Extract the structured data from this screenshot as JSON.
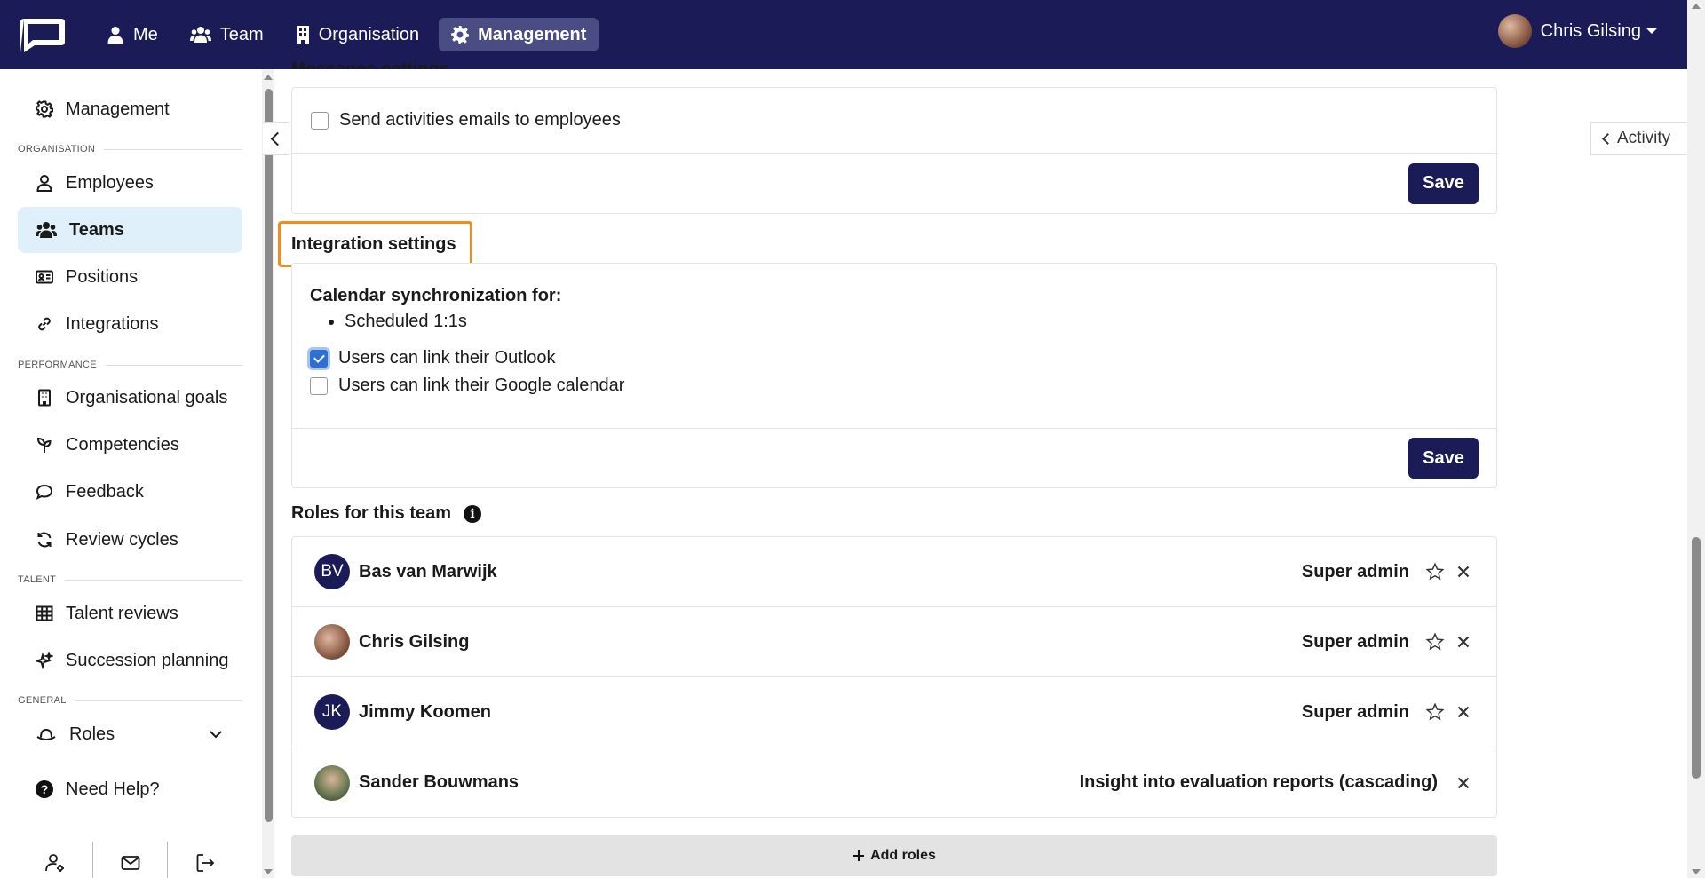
{
  "topbar": {
    "nav": [
      {
        "label": "Me",
        "icon": "person-icon"
      },
      {
        "label": "Team",
        "icon": "users-icon"
      },
      {
        "label": "Organisation",
        "icon": "building-icon"
      },
      {
        "label": "Management",
        "icon": "gear-icon",
        "active": true
      }
    ],
    "user_name": "Chris Gilsing"
  },
  "sidebar": {
    "top_item": "Management",
    "sections": {
      "organisation": "ORGANISATION",
      "performance": "PERFORMANCE",
      "talent": "TALENT",
      "general": "GENERAL"
    },
    "items": {
      "employees": "Employees",
      "teams": "Teams",
      "positions": "Positions",
      "integrations": "Integrations",
      "org_goals": "Organisational goals",
      "competencies": "Competencies",
      "feedback": "Feedback",
      "review_cycles": "Review cycles",
      "talent_reviews": "Talent reviews",
      "succession": "Succession planning",
      "roles": "Roles",
      "help": "Need Help?"
    }
  },
  "activity_label": "Activity",
  "messages": {
    "title": "Messages settings",
    "checkbox_label": "Send activities emails to employees",
    "checked": false,
    "save_label": "Save"
  },
  "integration": {
    "title": "Integration settings",
    "sync_heading": "Calendar synchronization for:",
    "sync_items": [
      "Scheduled 1:1s"
    ],
    "outlook_label": "Users can link their Outlook",
    "outlook_checked": true,
    "google_label": "Users can link their Google calendar",
    "google_checked": false,
    "save_label": "Save"
  },
  "roles": {
    "title": "Roles for this team",
    "rows": [
      {
        "initials": "BV",
        "name": "Bas van Marwijk",
        "role": "Super admin",
        "star": true
      },
      {
        "initials": "",
        "name": "Chris Gilsing",
        "role": "Super admin",
        "star": true
      },
      {
        "initials": "JK",
        "name": "Jimmy Koomen",
        "role": "Super admin",
        "star": true
      },
      {
        "initials": "",
        "name": "Sander Bouwmans",
        "role": "Insight into evaluation reports (cascading)",
        "star": false
      }
    ],
    "add_label": "Add roles"
  },
  "colors": {
    "brand_navy": "#1b1c57",
    "highlight_orange": "#f28c1e",
    "active_sidebar": "#dff0fb",
    "checkbox_blue": "#2f6fd1"
  }
}
